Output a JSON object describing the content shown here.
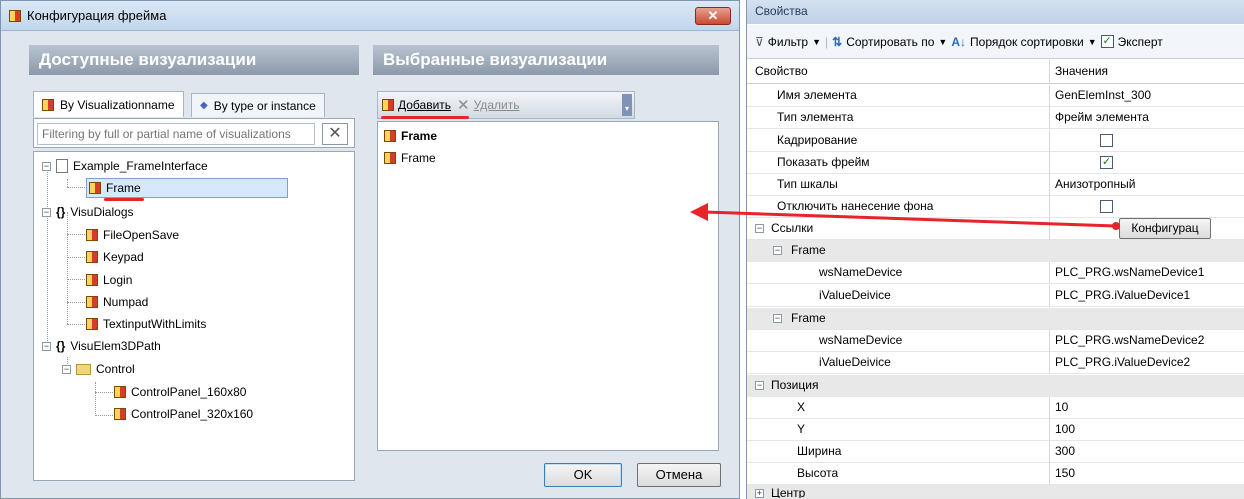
{
  "dialog": {
    "title": "Конфигурация фрейма",
    "available_heading": "Доступные визуализации",
    "selected_heading": "Выбранные визуализации",
    "tab_by_name": "By Visualizationname",
    "tab_by_type": "By type or instance",
    "filter_placeholder": "Filtering by full or partial name of visualizations",
    "tree": {
      "example": "Example_FrameInterface",
      "frame": "Frame",
      "visudialogs": "VisuDialogs",
      "fileopensave": "FileOpenSave",
      "keypad": "Keypad",
      "login": "Login",
      "numpad": "Numpad",
      "textinput": "TextinputWithLimits",
      "visuelem3d": "VisuElem3DPath",
      "control": "Control",
      "cp160": "ControlPanel_160x80",
      "cp320": "ControlPanel_320x160"
    },
    "add_label": "Добавить",
    "remove_label": "Удалить",
    "selected_items": [
      "Frame",
      "Frame"
    ],
    "ok": "OK",
    "cancel": "Отмена"
  },
  "props": {
    "title": "Свойства",
    "toolbar": {
      "filter": "Фильтр",
      "sort_by": "Сортировать по",
      "sort_order": "Порядок сортировки",
      "expert": "Эксперт"
    },
    "col_property": "Свойство",
    "col_values": "Значения",
    "rows": {
      "elem_name_k": "Имя элемента",
      "elem_name_v": "GenElemInst_300",
      "elem_type_k": "Тип элемента",
      "elem_type_v": "Фрейм элемента",
      "clipping_k": "Кадрирование",
      "show_frame_k": "Показать фрейм",
      "scale_type_k": "Тип шкалы",
      "scale_type_v": "Анизотропный",
      "disable_bg_k": "Отключить нанесение фона",
      "links_k": "Ссылки",
      "config_btn": "Конфигурац",
      "frame1_k": "Frame",
      "ws1_k": "wsNameDevice",
      "ws1_v": "PLC_PRG.wsNameDevice1",
      "iv1_k": "iValueDeivice",
      "iv1_v": "PLC_PRG.iValueDevice1",
      "frame2_k": "Frame",
      "ws2_k": "wsNameDevice",
      "ws2_v": "PLC_PRG.wsNameDevice2",
      "iv2_k": "iValueDeivice",
      "iv2_v": "PLC_PRG.iValueDevice2",
      "pos_k": "Позиция",
      "x_k": "X",
      "x_v": "10",
      "y_k": "Y",
      "y_v": "100",
      "w_k": "Ширина",
      "w_v": "300",
      "h_k": "Высота",
      "h_v": "150",
      "center_k": "Центр"
    }
  },
  "colors": {
    "annotation": "#e8232a"
  }
}
